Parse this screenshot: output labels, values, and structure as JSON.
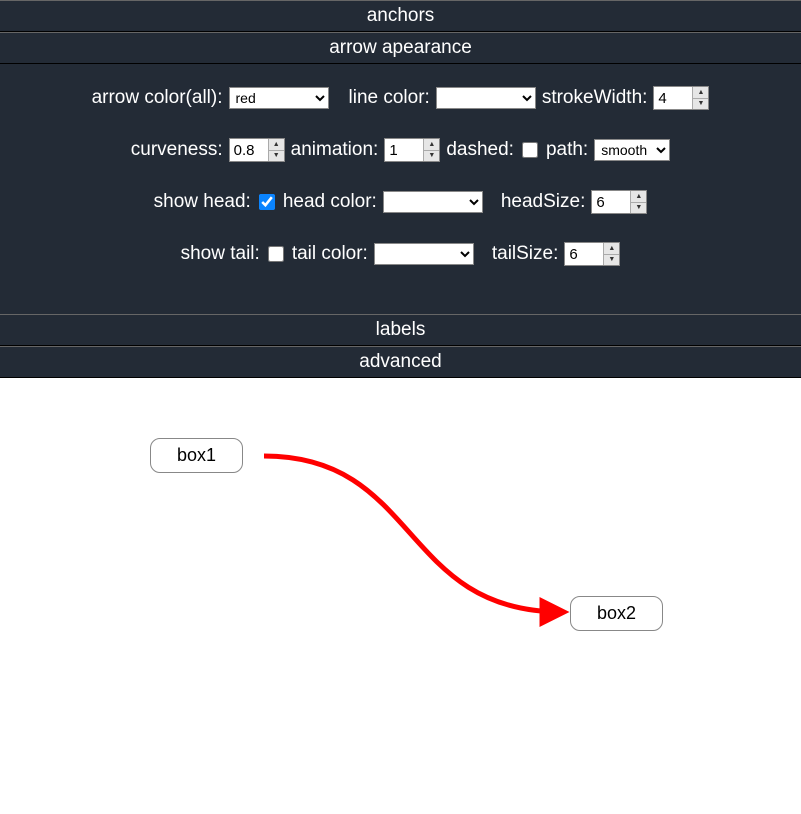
{
  "sections": {
    "anchors": "anchors",
    "arrow_appearance": "arrow apearance",
    "labels": "labels",
    "advanced": "advanced"
  },
  "controls": {
    "arrow_color_label": "arrow color(all):",
    "arrow_color_value": "red",
    "line_color_label": "line color:",
    "line_color_value": "",
    "stroke_width_label": "strokeWidth:",
    "stroke_width_value": "4",
    "curveness_label": "curveness:",
    "curveness_value": "0.8",
    "animation_label": "animation:",
    "animation_value": "1",
    "dashed_label": "dashed:",
    "dashed_checked": false,
    "path_label": "path:",
    "path_value": "smooth",
    "show_head_label": "show head:",
    "show_head_checked": true,
    "head_color_label": "head color:",
    "head_color_value": "",
    "head_size_label": "headSize:",
    "head_size_value": "6",
    "show_tail_label": "show tail:",
    "show_tail_checked": false,
    "tail_color_label": "tail color:",
    "tail_color_value": "",
    "tail_size_label": "tailSize:",
    "tail_size_value": "6"
  },
  "canvas": {
    "box1_label": "box1",
    "box2_label": "box2",
    "arrow_color": "red"
  }
}
